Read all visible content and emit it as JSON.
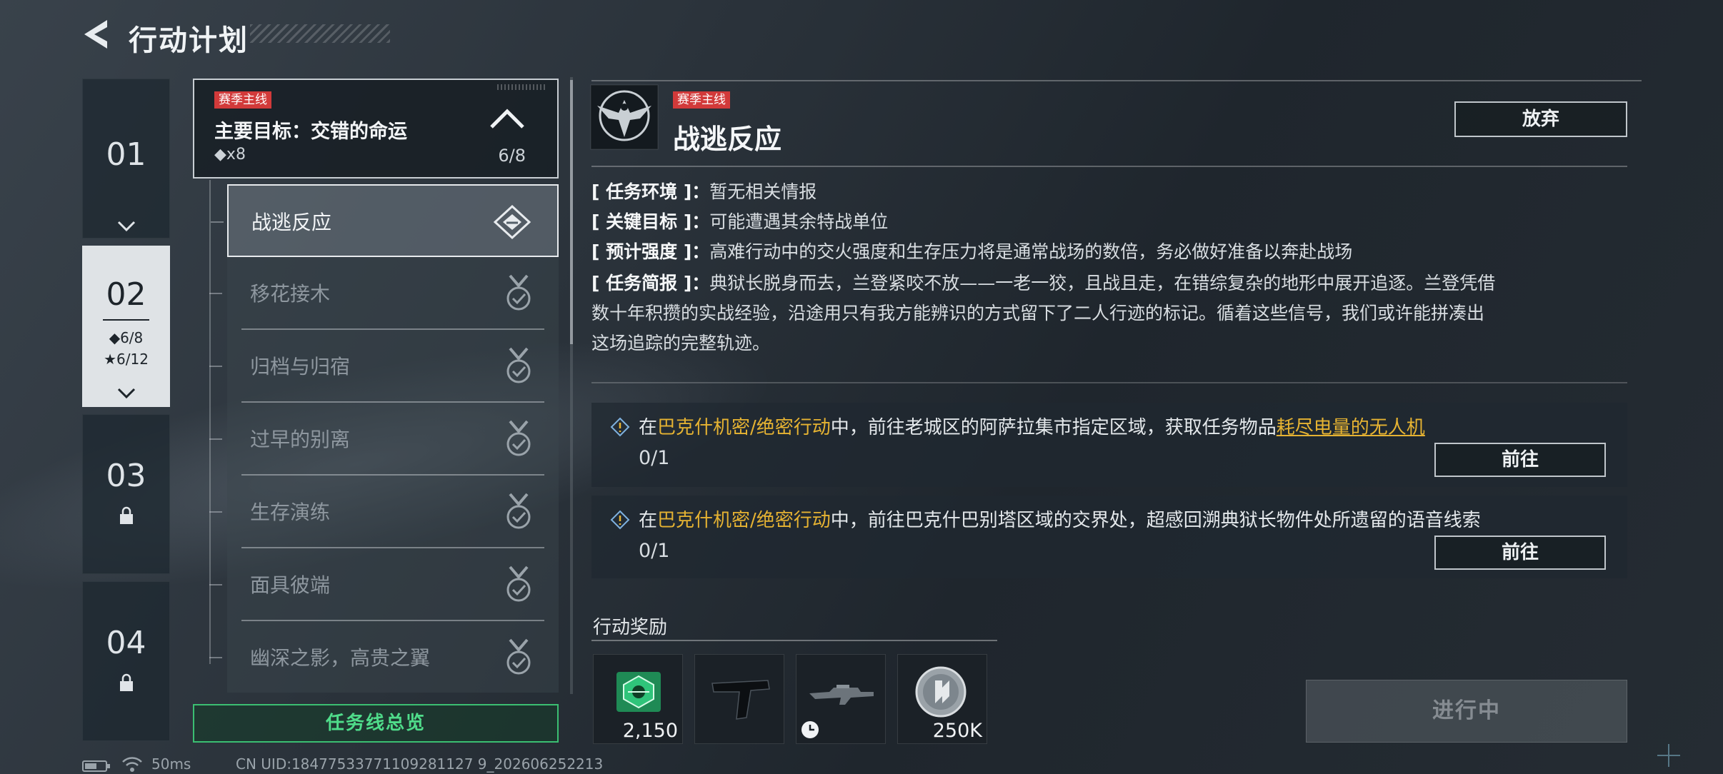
{
  "header": {
    "title": "行动计划"
  },
  "chapters": [
    {
      "num": "01",
      "state": "normal"
    },
    {
      "num": "02",
      "state": "active",
      "progress_main": "◆6/8",
      "progress_star": "★6/12"
    },
    {
      "num": "03",
      "state": "locked"
    },
    {
      "num": "04",
      "state": "locked"
    }
  ],
  "questline": {
    "tag": "赛季主线",
    "goal": "主要目标：交错的命运",
    "count": "◆x8",
    "progress": "6/8"
  },
  "missions": [
    {
      "name": "战逃反应",
      "selected": true
    },
    {
      "name": "移花接木"
    },
    {
      "name": "归档与归宿"
    },
    {
      "name": "过早的别离"
    },
    {
      "name": "生存演练"
    },
    {
      "name": "面具彼端"
    },
    {
      "name": "幽深之影，高贵之翼"
    }
  ],
  "overview_button": "任务线总览",
  "mission_detail": {
    "tag": "赛季主线",
    "title": "战逃反应",
    "abandon": "放弃",
    "env_key": "[ 任务环境 ]：",
    "env_val": "暂无相关情报",
    "target_key": "[ 关键目标 ]：",
    "target_val": "可能遭遇其余特战单位",
    "intensity_key": "[ 预计强度 ]：",
    "intensity_val": "高难行动中的交火强度和生存压力将是通常战场的数倍，务必做好准备以奔赴战场",
    "brief_key": "[ 任务简报 ]：",
    "brief_line1": "典狱长脱身而去，兰登紧咬不放——一老一狡，且战且走，在错综复杂的地形中展开追逐。兰登凭借",
    "brief_line2": "数十年积攒的实战经验，沿途用只有我方能辨识的方式留下了二人行迹的标记。循着这些信号，我们或许能拼凑出",
    "brief_line3": "这场追踪的完整轨迹。"
  },
  "objectives": [
    {
      "pre": "在",
      "hl": "巴克什机密/绝密行动",
      "mid": "中，前往老城区的阿萨拉集市指定区域，获取任务物品",
      "hlu": "耗尽电量的无人机",
      "post": "",
      "progress": "0/1",
      "button": "前往"
    },
    {
      "pre": "在",
      "hl": "巴克什机密/绝密行动",
      "mid": "中，前往巴克什巴别塔区域的交界处，超感回溯典狱长物件处所遗留的语音线索",
      "hlu": "",
      "post": "",
      "progress": "0/1",
      "button": "前往"
    }
  ],
  "rewards": {
    "label": "行动奖励",
    "items": [
      {
        "icon": "green-badge-icon",
        "qty": "2,150"
      },
      {
        "icon": "weapon-grip-icon",
        "qty": ""
      },
      {
        "icon": "rifle-icon",
        "qty": "",
        "timed": true
      },
      {
        "icon": "silver-coin-icon",
        "qty": "250K"
      }
    ]
  },
  "status_button": "进行中",
  "statusbar": {
    "ping": "50ms",
    "uid": "CN UID:18477533771109281127 9_202606252213"
  },
  "colors": {
    "accent_green": "#4fdc8a",
    "tag_red": "#d23a3a",
    "highlight_gold": "#e6b332"
  }
}
